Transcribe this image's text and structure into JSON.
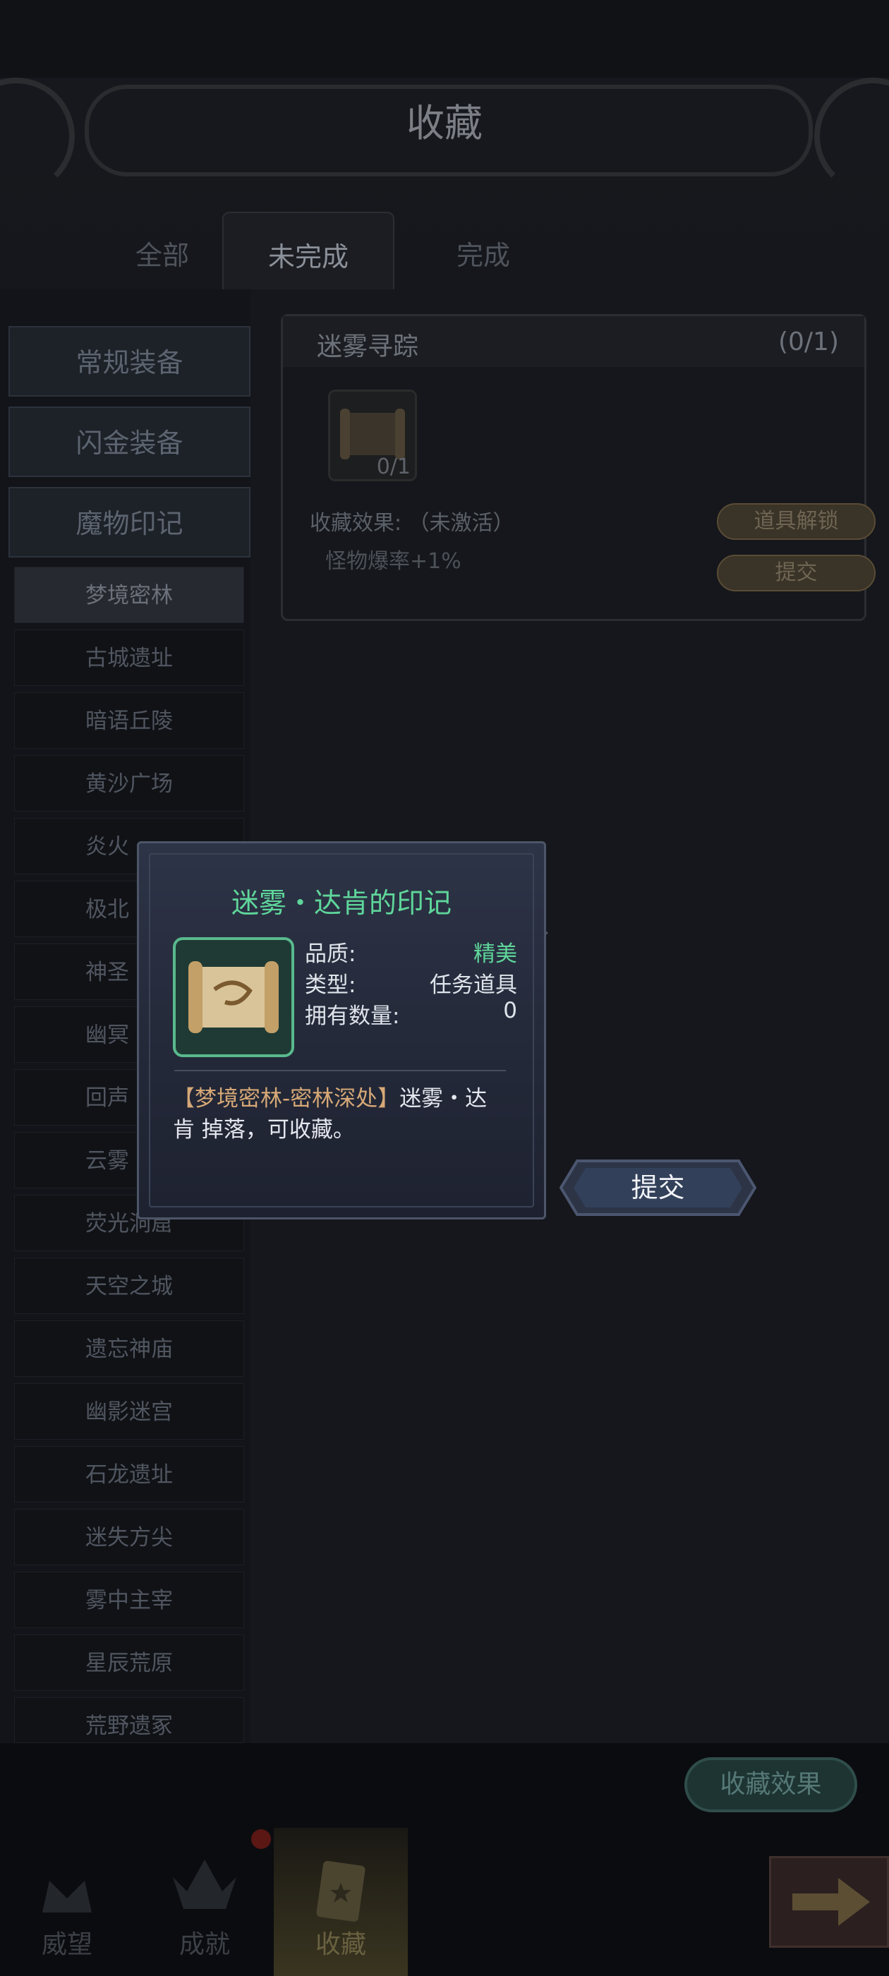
{
  "header": {
    "title": "收藏"
  },
  "tabs": [
    {
      "label": "全部",
      "active": false
    },
    {
      "label": "未完成",
      "active": true
    },
    {
      "label": "完成",
      "active": false
    }
  ],
  "sidebar": {
    "categories": [
      {
        "label": "常规装备"
      },
      {
        "label": "闪金装备"
      },
      {
        "label": "魔物印记"
      }
    ],
    "subitems": [
      {
        "label": "梦境密林",
        "selected": true
      },
      {
        "label": "古城遗址"
      },
      {
        "label": "暗语丘陵"
      },
      {
        "label": "黄沙广场"
      },
      {
        "label": "炎火"
      },
      {
        "label": "极北"
      },
      {
        "label": "神圣"
      },
      {
        "label": "幽冥"
      },
      {
        "label": "回声"
      },
      {
        "label": "云雾"
      },
      {
        "label": "荧光洞窟"
      },
      {
        "label": "天空之城"
      },
      {
        "label": "遗忘神庙"
      },
      {
        "label": "幽影迷宫"
      },
      {
        "label": "石龙遗址"
      },
      {
        "label": "迷失方尖"
      },
      {
        "label": "雾中主宰"
      },
      {
        "label": "星辰荒原"
      },
      {
        "label": "荒野遗冢"
      }
    ]
  },
  "card": {
    "name": "迷雾寻踪",
    "progress": "(0/1)",
    "item_qty": "0/1",
    "effect_label": "收藏效果: （未激活）",
    "effect_value": "怪物爆率+1%",
    "unlock_button": "道具解锁",
    "submit_button": "提交"
  },
  "collection_effect_button": "收藏效果",
  "bottom_nav": [
    {
      "label": "威望",
      "icon": "crown-icon"
    },
    {
      "label": "成就",
      "icon": "wings-icon"
    },
    {
      "label": "收藏",
      "icon": "scroll-icon",
      "active": true
    }
  ],
  "popup": {
    "title": "迷雾・达肯的印记",
    "quality_label": "品质:",
    "quality_value": "精美",
    "type_label": "类型:",
    "type_value": "任务道具",
    "owned_label": "拥有数量:",
    "owned_value": "0",
    "desc_source": "【梦境密林-密林深处】",
    "desc_text": "迷雾・达肯 掉落，可收藏。",
    "colors": {
      "title": "#5fd69a",
      "quality": "#5fd69a",
      "source": "#d6a877"
    }
  },
  "submit_big": "提交"
}
